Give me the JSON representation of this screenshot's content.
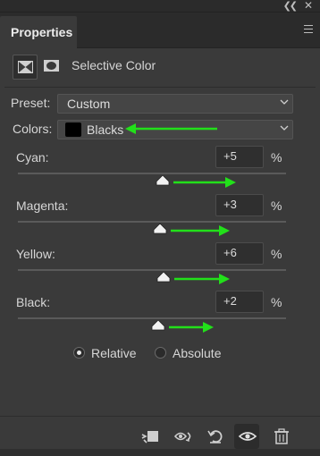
{
  "panel": {
    "tab_label": "Properties",
    "adjustment_title": "Selective Color"
  },
  "preset": {
    "label": "Preset:",
    "value": "Custom"
  },
  "colors": {
    "label": "Colors:",
    "value": "Blacks",
    "swatch_color": "#000000"
  },
  "sliders": [
    {
      "label": "Cyan:",
      "value": "+5",
      "unit": "%",
      "level": 5
    },
    {
      "label": "Magenta:",
      "value": "+3",
      "unit": "%",
      "level": 3
    },
    {
      "label": "Yellow:",
      "value": "+6",
      "unit": "%",
      "level": 6
    },
    {
      "label": "Black:",
      "value": "+2",
      "unit": "%",
      "level": 2
    }
  ],
  "method": {
    "relative_label": "Relative",
    "absolute_label": "Absolute",
    "selected": "Relative"
  },
  "bottom_icons": [
    "clip-to-layer-icon",
    "view-previous-state-icon",
    "reset-icon",
    "visibility-icon",
    "trash-icon"
  ],
  "accent_colors": {
    "annotation_arrow": "#22e01a"
  }
}
